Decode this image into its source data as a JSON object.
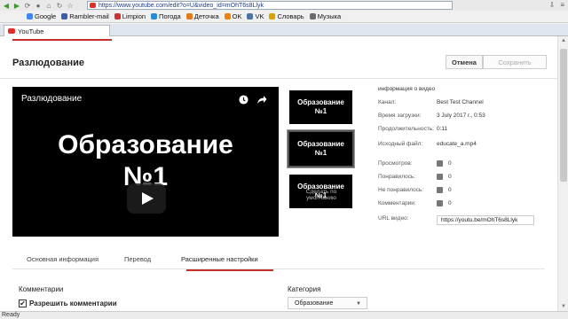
{
  "browser": {
    "url": "https://www.youtube.com/edit?o=U&video_id=mOhT6s8Llyk",
    "bookmarks": [
      {
        "label": "Google",
        "color": "#4285f4"
      },
      {
        "label": "Rambler-mail",
        "color": "#3a5fa8"
      },
      {
        "label": "Limpion",
        "color": "#c33"
      },
      {
        "label": "Погода",
        "color": "#2a8ad4"
      },
      {
        "label": "Деточка",
        "color": "#e07a1a"
      },
      {
        "label": "OK",
        "color": "#ee8208"
      },
      {
        "label": "VK",
        "color": "#4c75a3"
      },
      {
        "label": "Словарь",
        "color": "#d9a400"
      },
      {
        "label": "Музыка",
        "color": "#6b6b6b"
      }
    ],
    "tab_title": "YouTube",
    "status": "Ready"
  },
  "page": {
    "title": "Разлюдование",
    "cancel_label": "Отмена",
    "save_label": "Сохранить"
  },
  "player": {
    "title": "Разлюдование",
    "big_line1": "Образование",
    "big_line2": "№1"
  },
  "thumbnails": [
    {
      "line1": "Образование",
      "line2": "№1"
    },
    {
      "line1": "Образование",
      "line2": "№1"
    },
    {
      "line1": "Образование",
      "line2": "№1",
      "overlay": "Сделать по умолчанию"
    }
  ],
  "info": {
    "heading": "информация о видео",
    "channel_label": "Канал:",
    "channel_value": "Best Test Channel",
    "upload_label": "Время загрузки:",
    "upload_value": "3 July 2017 г., 0:53",
    "duration_label": "Продолжительность:",
    "duration_value": "0:11",
    "file_label": "Исходный файл:",
    "file_value": "educate_a.mp4",
    "views_label": "Просмотров:",
    "views_value": "0",
    "likes_label": "Понравилось:",
    "likes_value": "0",
    "dislikes_label": "Не понравилось:",
    "dislikes_value": "0",
    "comments_label": "Комментарии:",
    "comments_value": "0",
    "url_label": "URL видео:",
    "url_value": "https://youtu.be/mOhT6s8Llyk"
  },
  "tabs": [
    "Основная информация",
    "Перевод",
    "Расширенные настройки"
  ],
  "settings": {
    "comments_heading": "Комментарии",
    "allow_comments_label": "Разрешить комментарии",
    "allow_comments_checked": true,
    "category_heading": "Категория",
    "category_value": "Образование"
  },
  "colors": {
    "accent": "#c4302b",
    "youtube_red": "#e52d27"
  }
}
